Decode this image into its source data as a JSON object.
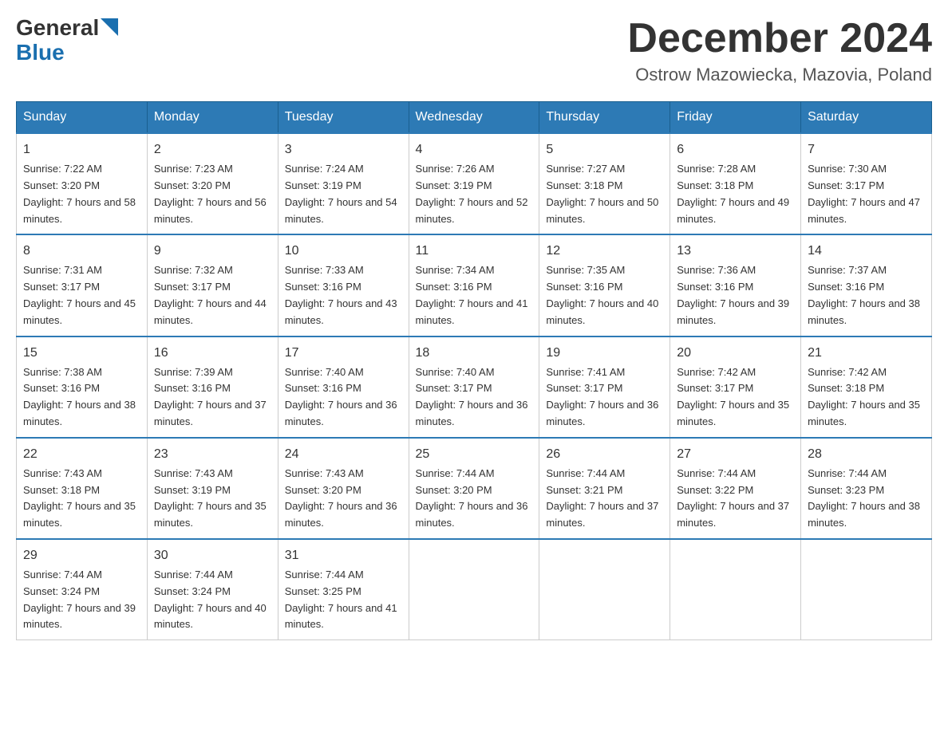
{
  "logo": {
    "general": "General",
    "blue": "Blue"
  },
  "header": {
    "month": "December 2024",
    "location": "Ostrow Mazowiecka, Mazovia, Poland"
  },
  "days_of_week": [
    "Sunday",
    "Monday",
    "Tuesday",
    "Wednesday",
    "Thursday",
    "Friday",
    "Saturday"
  ],
  "weeks": [
    [
      {
        "day": "1",
        "sunrise": "7:22 AM",
        "sunset": "3:20 PM",
        "daylight": "7 hours and 58 minutes."
      },
      {
        "day": "2",
        "sunrise": "7:23 AM",
        "sunset": "3:20 PM",
        "daylight": "7 hours and 56 minutes."
      },
      {
        "day": "3",
        "sunrise": "7:24 AM",
        "sunset": "3:19 PM",
        "daylight": "7 hours and 54 minutes."
      },
      {
        "day": "4",
        "sunrise": "7:26 AM",
        "sunset": "3:19 PM",
        "daylight": "7 hours and 52 minutes."
      },
      {
        "day": "5",
        "sunrise": "7:27 AM",
        "sunset": "3:18 PM",
        "daylight": "7 hours and 50 minutes."
      },
      {
        "day": "6",
        "sunrise": "7:28 AM",
        "sunset": "3:18 PM",
        "daylight": "7 hours and 49 minutes."
      },
      {
        "day": "7",
        "sunrise": "7:30 AM",
        "sunset": "3:17 PM",
        "daylight": "7 hours and 47 minutes."
      }
    ],
    [
      {
        "day": "8",
        "sunrise": "7:31 AM",
        "sunset": "3:17 PM",
        "daylight": "7 hours and 45 minutes."
      },
      {
        "day": "9",
        "sunrise": "7:32 AM",
        "sunset": "3:17 PM",
        "daylight": "7 hours and 44 minutes."
      },
      {
        "day": "10",
        "sunrise": "7:33 AM",
        "sunset": "3:16 PM",
        "daylight": "7 hours and 43 minutes."
      },
      {
        "day": "11",
        "sunrise": "7:34 AM",
        "sunset": "3:16 PM",
        "daylight": "7 hours and 41 minutes."
      },
      {
        "day": "12",
        "sunrise": "7:35 AM",
        "sunset": "3:16 PM",
        "daylight": "7 hours and 40 minutes."
      },
      {
        "day": "13",
        "sunrise": "7:36 AM",
        "sunset": "3:16 PM",
        "daylight": "7 hours and 39 minutes."
      },
      {
        "day": "14",
        "sunrise": "7:37 AM",
        "sunset": "3:16 PM",
        "daylight": "7 hours and 38 minutes."
      }
    ],
    [
      {
        "day": "15",
        "sunrise": "7:38 AM",
        "sunset": "3:16 PM",
        "daylight": "7 hours and 38 minutes."
      },
      {
        "day": "16",
        "sunrise": "7:39 AM",
        "sunset": "3:16 PM",
        "daylight": "7 hours and 37 minutes."
      },
      {
        "day": "17",
        "sunrise": "7:40 AM",
        "sunset": "3:16 PM",
        "daylight": "7 hours and 36 minutes."
      },
      {
        "day": "18",
        "sunrise": "7:40 AM",
        "sunset": "3:17 PM",
        "daylight": "7 hours and 36 minutes."
      },
      {
        "day": "19",
        "sunrise": "7:41 AM",
        "sunset": "3:17 PM",
        "daylight": "7 hours and 36 minutes."
      },
      {
        "day": "20",
        "sunrise": "7:42 AM",
        "sunset": "3:17 PM",
        "daylight": "7 hours and 35 minutes."
      },
      {
        "day": "21",
        "sunrise": "7:42 AM",
        "sunset": "3:18 PM",
        "daylight": "7 hours and 35 minutes."
      }
    ],
    [
      {
        "day": "22",
        "sunrise": "7:43 AM",
        "sunset": "3:18 PM",
        "daylight": "7 hours and 35 minutes."
      },
      {
        "day": "23",
        "sunrise": "7:43 AM",
        "sunset": "3:19 PM",
        "daylight": "7 hours and 35 minutes."
      },
      {
        "day": "24",
        "sunrise": "7:43 AM",
        "sunset": "3:20 PM",
        "daylight": "7 hours and 36 minutes."
      },
      {
        "day": "25",
        "sunrise": "7:44 AM",
        "sunset": "3:20 PM",
        "daylight": "7 hours and 36 minutes."
      },
      {
        "day": "26",
        "sunrise": "7:44 AM",
        "sunset": "3:21 PM",
        "daylight": "7 hours and 37 minutes."
      },
      {
        "day": "27",
        "sunrise": "7:44 AM",
        "sunset": "3:22 PM",
        "daylight": "7 hours and 37 minutes."
      },
      {
        "day": "28",
        "sunrise": "7:44 AM",
        "sunset": "3:23 PM",
        "daylight": "7 hours and 38 minutes."
      }
    ],
    [
      {
        "day": "29",
        "sunrise": "7:44 AM",
        "sunset": "3:24 PM",
        "daylight": "7 hours and 39 minutes."
      },
      {
        "day": "30",
        "sunrise": "7:44 AM",
        "sunset": "3:24 PM",
        "daylight": "7 hours and 40 minutes."
      },
      {
        "day": "31",
        "sunrise": "7:44 AM",
        "sunset": "3:25 PM",
        "daylight": "7 hours and 41 minutes."
      },
      null,
      null,
      null,
      null
    ]
  ],
  "labels": {
    "sunrise_prefix": "Sunrise: ",
    "sunset_prefix": "Sunset: ",
    "daylight_prefix": "Daylight: "
  }
}
